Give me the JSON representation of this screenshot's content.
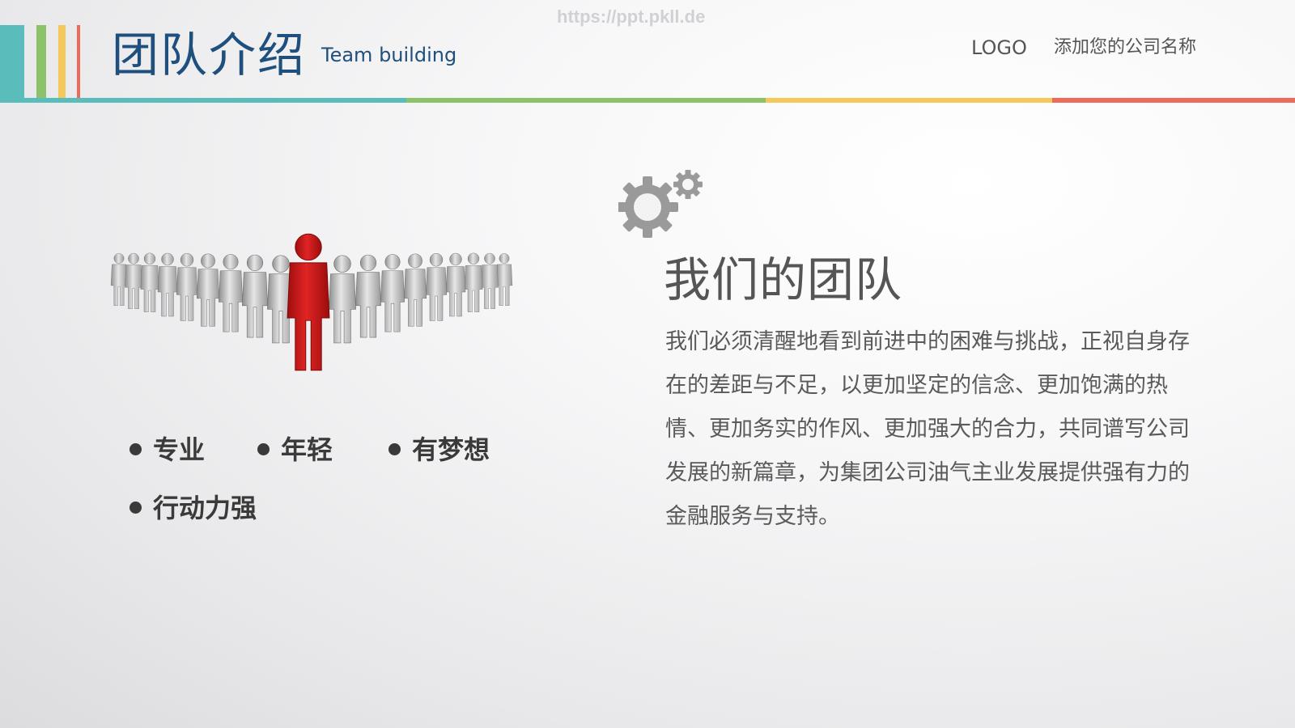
{
  "header": {
    "title": "团队介绍",
    "subtitle": "Team building",
    "watermark": "https://ppt.pkll.de",
    "logo": "LOGO",
    "company": "添加您的公司名称"
  },
  "colors": {
    "teal": "#5bbdbb",
    "green": "#8cc36a",
    "yellow": "#f5c85c",
    "red": "#ee6b5b",
    "title_blue": "#1f4f7c",
    "figure_red": "#d41c1c"
  },
  "icons": [
    "gears-icon",
    "people-group-illustration"
  ],
  "keywords": [
    "专业",
    "年轻",
    "有梦想",
    "行动力强"
  ],
  "section": {
    "heading": "我们的团队",
    "body": "我们必须清醒地看到前进中的困难与挑战，正视自身存在的差距与不足，以更加坚定的信念、更加饱满的热情、更加务实的作风、更加强大的合力，共同谱写公司发展的新篇章，为集团公司油气主业发展提供强有力的金融服务与支持。"
  }
}
